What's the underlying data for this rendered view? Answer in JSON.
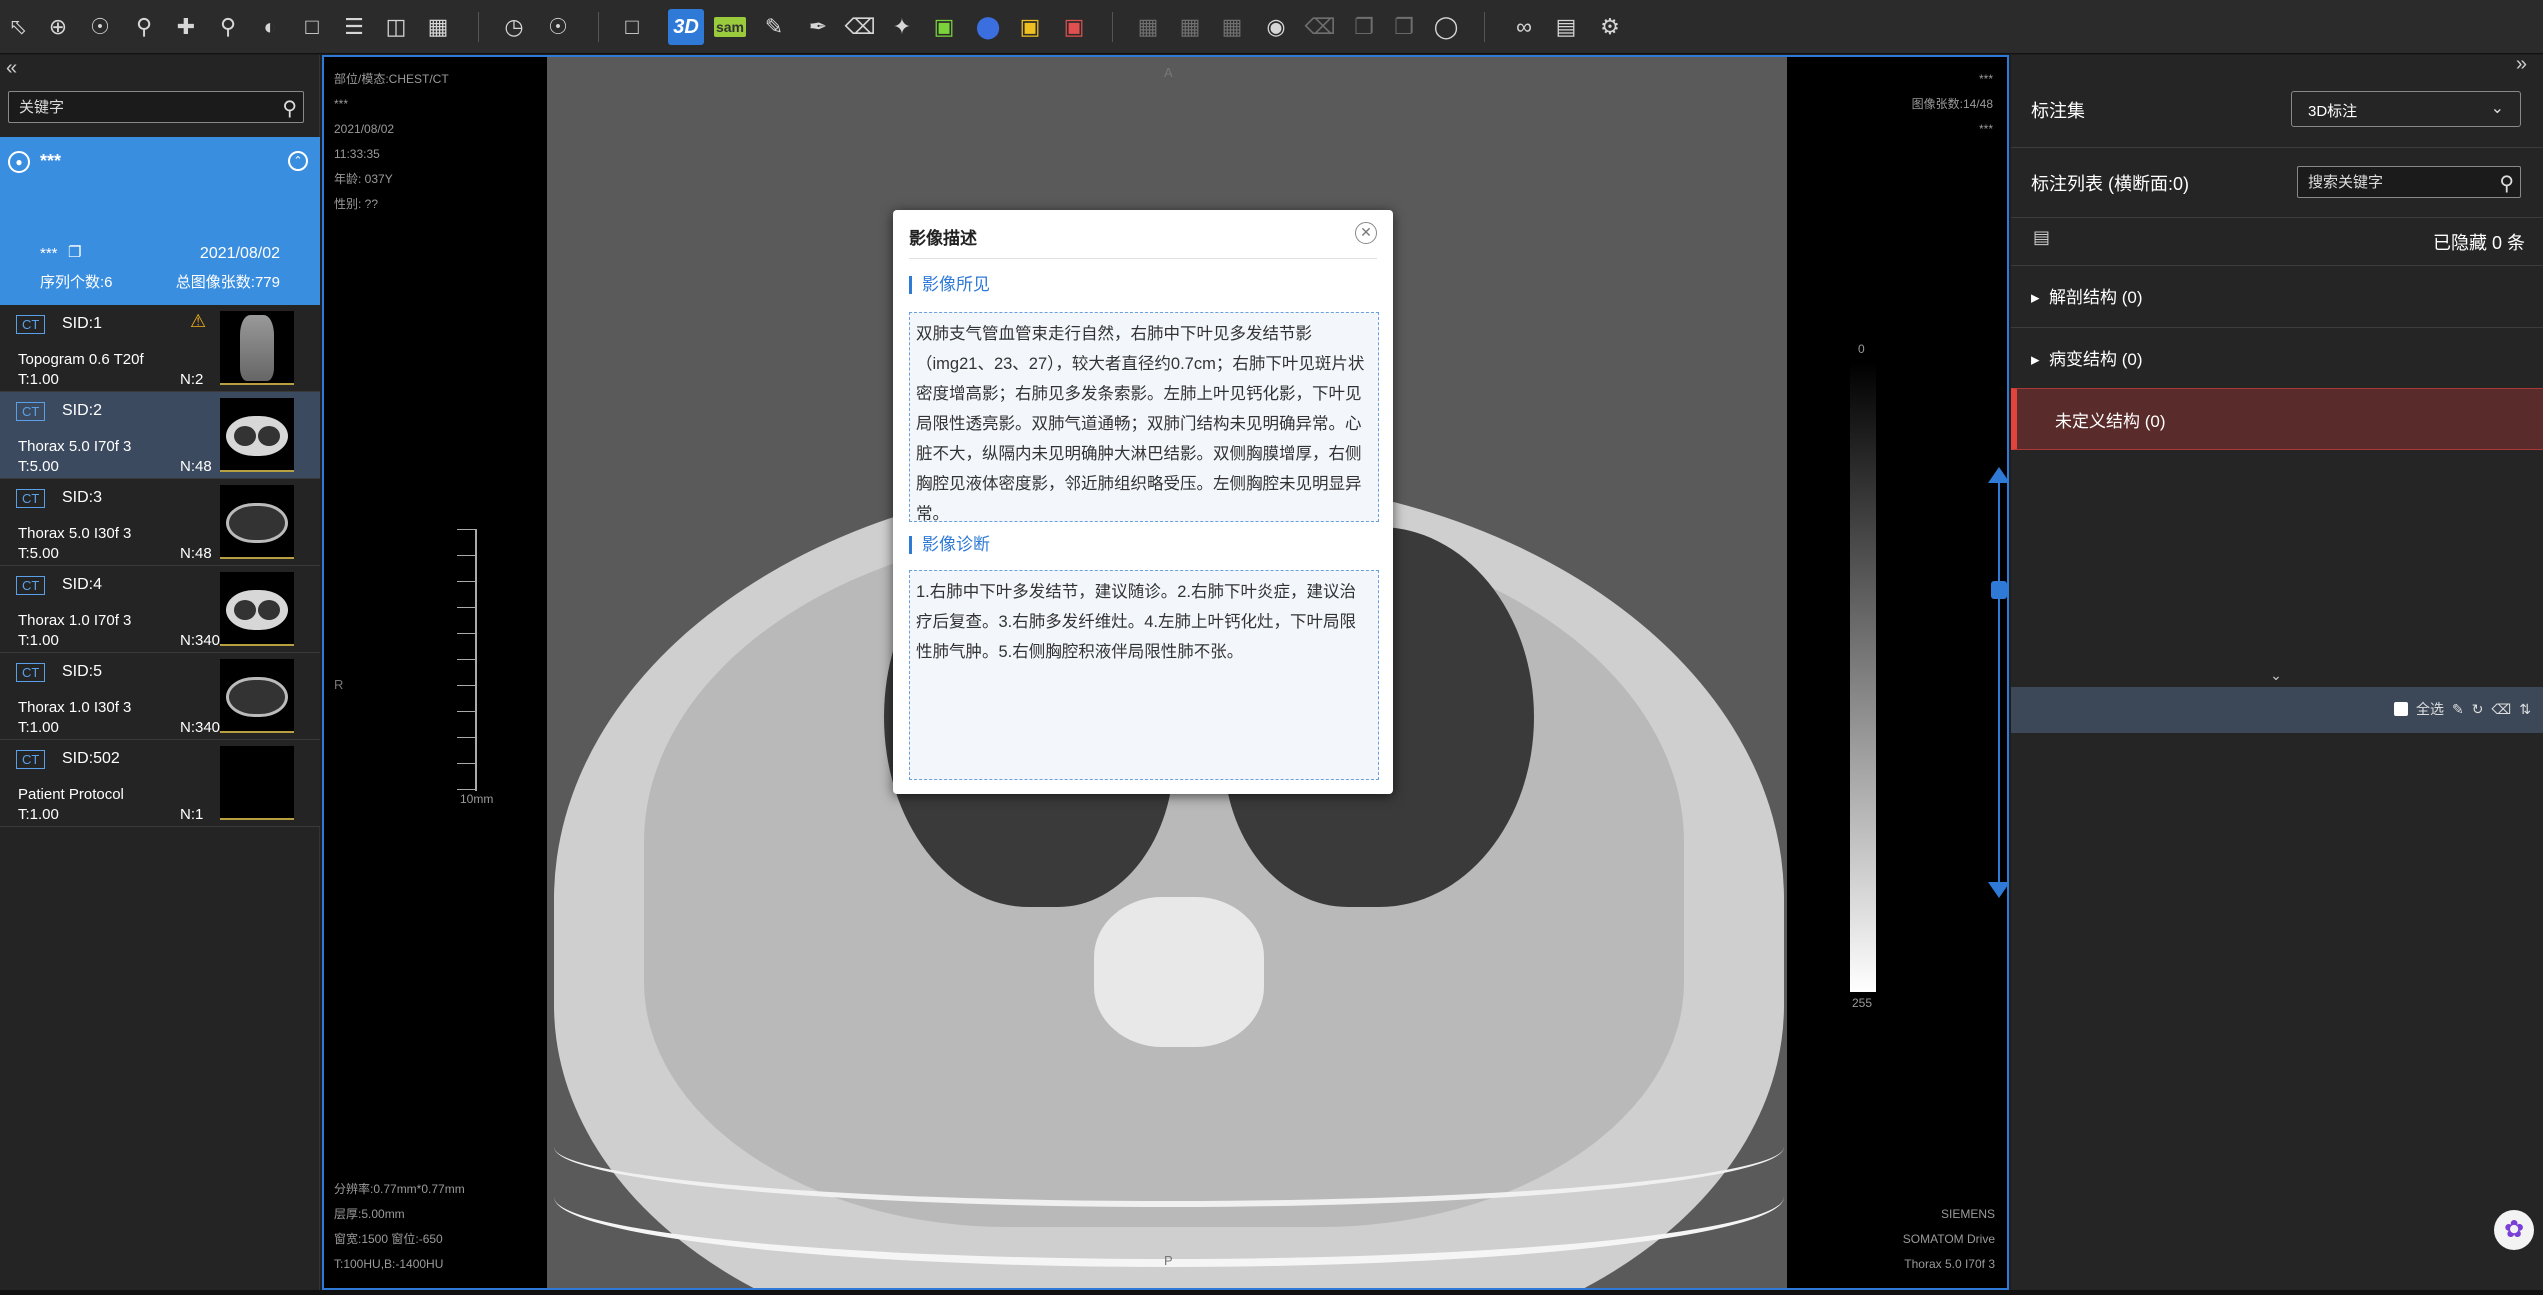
{
  "toolbar": {
    "tools": [
      "pointer",
      "crosshair",
      "zoom-in",
      "magnify",
      "pan",
      "search",
      "window-level",
      "crop",
      "list",
      "layout-1",
      "layout-4",
      "cine",
      "globe",
      "roi-select",
      "3d",
      "sam",
      "annotate-edit",
      "brush",
      "eraser",
      "magic-wand",
      "cube",
      "sphere",
      "box-3d",
      "color-cube",
      "grid-a",
      "grid-b",
      "grid-c",
      "eye",
      "delete",
      "copy",
      "paste",
      "lasso",
      "link",
      "report",
      "settings"
    ],
    "label_3d": "3D",
    "label_sam": "sam"
  },
  "left": {
    "search_placeholder": "关键字",
    "patient": {
      "name": "***",
      "id": "***",
      "date": "2021/08/02",
      "series_count": "序列个数:6",
      "total_images": "总图像张数:779"
    },
    "series": [
      {
        "modality": "CT",
        "sid": "SID:1",
        "desc": "Topogram 0.6 T20f",
        "t": "T:1.00",
        "n": "N:2",
        "warning": true,
        "thumb": "topo"
      },
      {
        "modality": "CT",
        "sid": "SID:2",
        "desc": "Thorax 5.0 I70f 3",
        "t": "T:5.00",
        "n": "N:48",
        "warning": false,
        "thumb": "light"
      },
      {
        "modality": "CT",
        "sid": "SID:3",
        "desc": "Thorax 5.0 I30f 3",
        "t": "T:5.00",
        "n": "N:48",
        "warning": false,
        "thumb": "dark"
      },
      {
        "modality": "CT",
        "sid": "SID:4",
        "desc": "Thorax 1.0 I70f 3",
        "t": "T:1.00",
        "n": "N:340",
        "warning": false,
        "thumb": "light"
      },
      {
        "modality": "CT",
        "sid": "SID:5",
        "desc": "Thorax 1.0 I30f 3",
        "t": "T:1.00",
        "n": "N:340",
        "warning": false,
        "thumb": "dark"
      },
      {
        "modality": "CT",
        "sid": "SID:502",
        "desc": "Patient Protocol",
        "t": "T:1.00",
        "n": "N:1",
        "warning": false,
        "thumb": "empty"
      }
    ],
    "selected_series": 1
  },
  "viewer": {
    "top_left": [
      "部位/模态:CHEST/CT",
      "***",
      "2021/08/02",
      "11:33:35",
      "年龄: 037Y",
      "性别: ??"
    ],
    "top_right_dots": "***",
    "image_count": "图像张数:14/48",
    "top_right_dots2": "***",
    "bottom_left": [
      "分辨率:0.77mm*0.77mm",
      "层厚:5.00mm",
      "窗宽:1500 窗位:-650",
      "T:100HU,B:-1400HU"
    ],
    "bottom_right": [
      "SIEMENS",
      "SOMATOM Drive",
      "Thorax 5.0 I70f 3"
    ],
    "orient_top": "A",
    "orient_bottom": "P",
    "orient_left": "R",
    "ruler_label": "10mm",
    "gray_min": "0",
    "gray_max": "255"
  },
  "dialog": {
    "title": "影像描述",
    "findings_title": "影像所见",
    "findings": "双肺支气管血管束走行自然，右肺中下叶见多发结节影（img21、23、27），较大者直径约0.7cm；右肺下叶见斑片状密度增高影；右肺见多发条索影。左肺上叶见钙化影，下叶见局限性透亮影。双肺气道通畅；双肺门结构未见明确异常。心脏不大，纵隔内未见明确肿大淋巴结影。双侧胸膜增厚，右侧胸腔见液体密度影，邻近肺组织略受压。左侧胸腔未见明显异常。",
    "diagnosis_title": "影像诊断",
    "diagnosis": "1.右肺中下叶多发结节，建议随诊。2.右肺下叶炎症，建议治疗后复查。3.右肺多发纤维灶。4.左肺上叶钙化灶，下叶局限性肺气肿。5.右侧胸腔积液伴局限性肺不张。"
  },
  "right": {
    "annotation_set_label": "标注集",
    "annotation_set_value": "3D标注",
    "list_label": "标注列表 (横断面:0)",
    "search_placeholder": "搜索关键字",
    "hidden_count": "已隐藏 0 条",
    "anatomy": "解剖结构 (0)",
    "lesion": "病变结构 (0)",
    "undefined": "未定义结构 (0)",
    "select_all": "全选"
  },
  "colors": {
    "accent": "#2f7ad6",
    "patient_bg": "#3a8ee0",
    "warning": "#f2b01e",
    "danger": "#e2433a"
  }
}
